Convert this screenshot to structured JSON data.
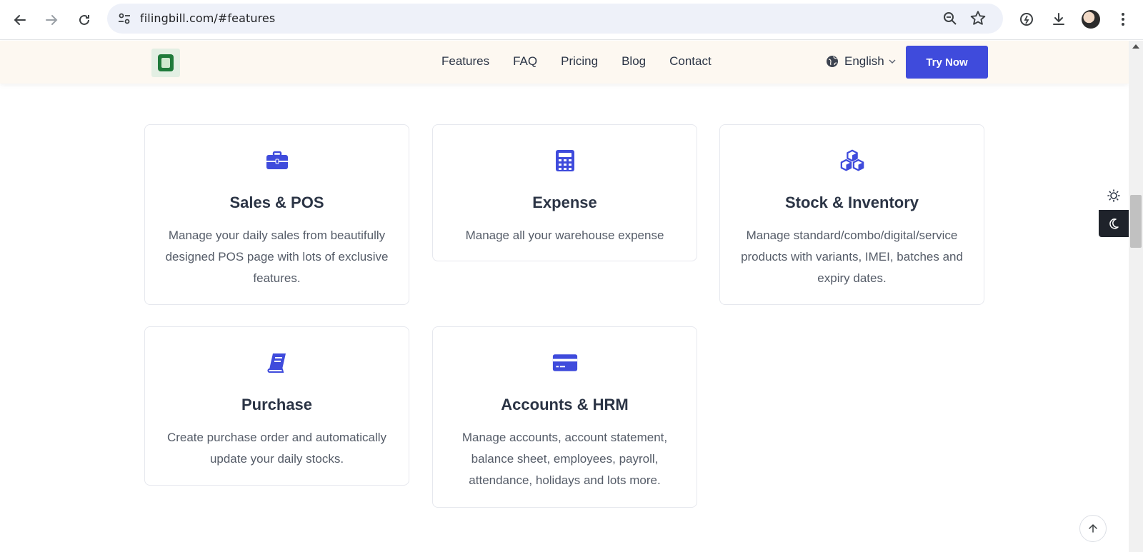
{
  "browser": {
    "url": "filingbill.com/#features",
    "icons": [
      "back-arrow-icon",
      "forward-arrow-icon",
      "reload-icon",
      "site-settings-icon",
      "zoom-icon",
      "bookmark-star-icon",
      "extension-icon",
      "download-icon",
      "avatar",
      "kebab-menu-icon"
    ]
  },
  "header": {
    "nav": [
      "Features",
      "FAQ",
      "Pricing",
      "Blog",
      "Contact"
    ],
    "language": "English",
    "cta_label": "Try Now",
    "accent_color": "#3f4bdc"
  },
  "features": [
    {
      "title": "Sales & POS",
      "description": "Manage your daily sales from beautifully designed POS page with lots of exclusive features.",
      "icon": "briefcase-icon"
    },
    {
      "title": "Expense",
      "description": "Manage all your warehouse expense",
      "icon": "calculator-icon"
    },
    {
      "title": "Stock & Inventory",
      "description": "Manage standard/combo/digital/service products with variants, IMEI, batches and expiry dates.",
      "icon": "boxes-icon"
    },
    {
      "title": "Purchase",
      "description": "Create purchase order and automatically update your daily stocks.",
      "icon": "book-icon"
    },
    {
      "title": "Accounts & HRM",
      "description": "Manage accounts, account statement, balance sheet, employees, payroll, attendance, holidays and lots more.",
      "icon": "credit-card-icon"
    }
  ],
  "theme_toggle": {
    "options": [
      "light",
      "dark"
    ],
    "active": "dark"
  }
}
